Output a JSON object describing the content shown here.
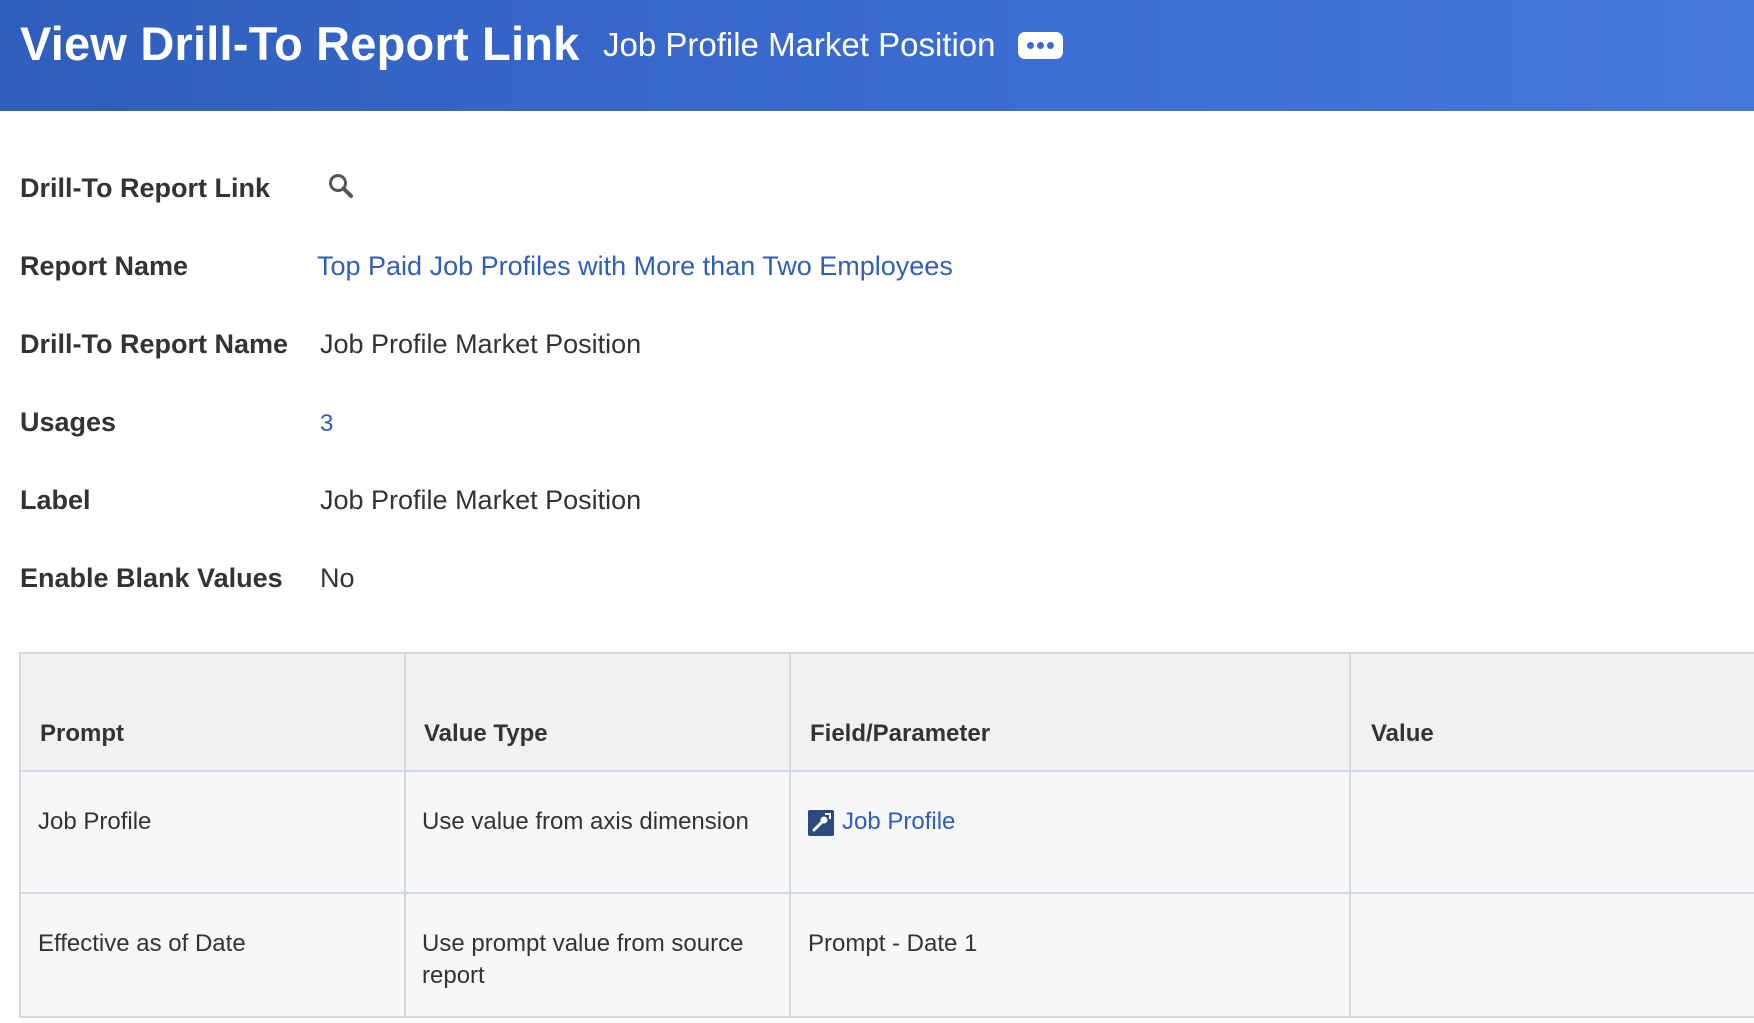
{
  "header": {
    "title": "View Drill-To Report Link",
    "subtitle": "Job Profile Market Position",
    "more_icon": "ellipsis-icon"
  },
  "fields": {
    "drill_to_report_link": {
      "label": "Drill-To Report Link",
      "icon": "search-icon"
    },
    "report_name": {
      "label": "Report Name",
      "value": "Top Paid Job Profiles with More than Two Employees"
    },
    "drill_to_report_name": {
      "label": "Drill-To Report Name",
      "value": "Job Profile Market Position"
    },
    "usages": {
      "label": "Usages",
      "value": "3"
    },
    "label": {
      "label": "Label",
      "value": "Job Profile Market Position"
    },
    "enable_blank_values": {
      "label": "Enable Blank Values",
      "value": "No"
    }
  },
  "table": {
    "columns": [
      "Prompt",
      "Value Type",
      "Field/Parameter",
      "Value"
    ],
    "rows": [
      {
        "prompt": "Job Profile",
        "value_type": "Use value from axis dimension",
        "field_parameter": "Job Profile",
        "field_icon": "field-link-icon",
        "value": ""
      },
      {
        "prompt": "Effective as of Date",
        "value_type_line1": "Use prompt value from source",
        "value_type_line2": "report",
        "field_parameter": "Prompt - Date 1",
        "value": ""
      }
    ]
  },
  "colors": {
    "header_bg": "#3b6cd2",
    "link": "#2f5ebb",
    "table_header_bg": "#f0f1f3",
    "row_bg": "#f6f7f8"
  }
}
